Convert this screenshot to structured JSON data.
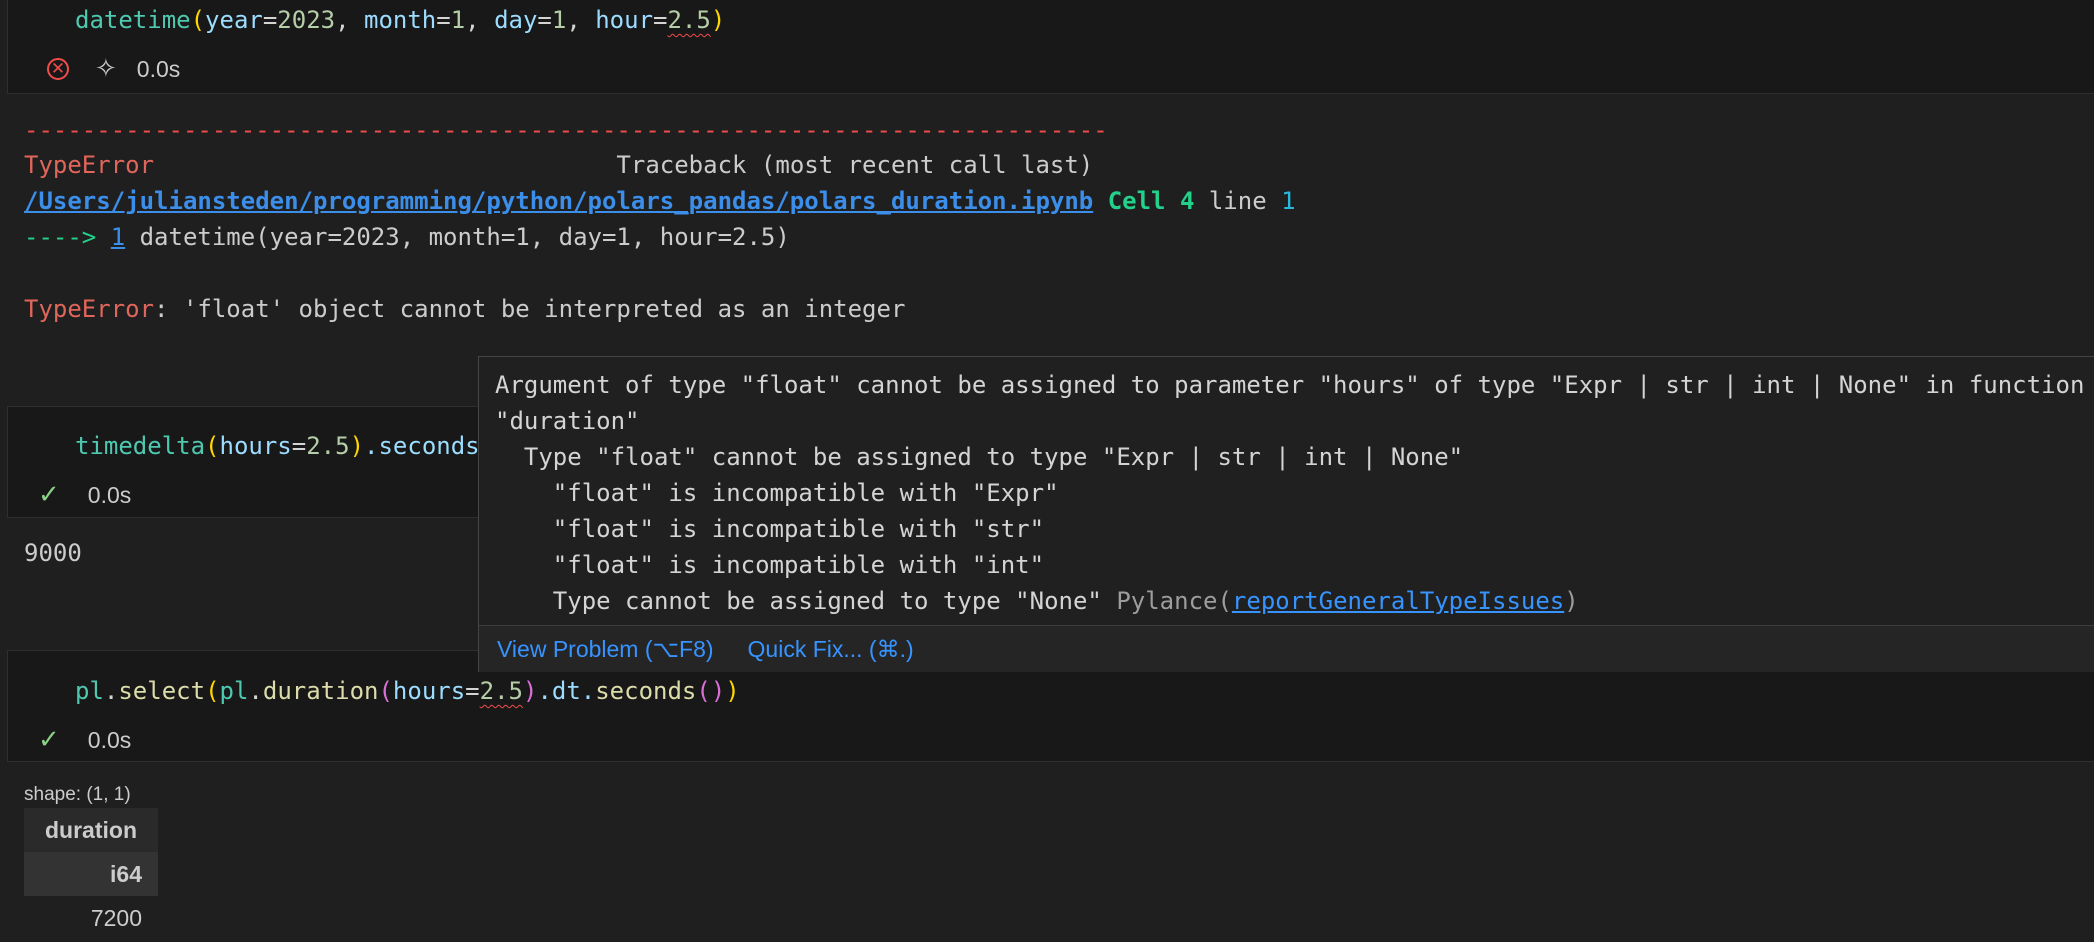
{
  "cell1": {
    "code": {
      "fn": "datetime",
      "open": "(",
      "p1": "year",
      "eq": "=",
      "v1": "2023",
      "comma": ", ",
      "p2": "month",
      "v2": "1",
      "p3": "day",
      "v3": "1",
      "p4": "hour",
      "v4": "2.5",
      "close": ")"
    },
    "time": "0.0s"
  },
  "error_output": {
    "dashes": "---------------------------------------------------------------------------",
    "error_type": "TypeError",
    "traceback_label": "Traceback (most recent call last)",
    "file_path": "/Users/juliansteden/programming/python/polars_pandas/polars_duration.ipynb",
    "cell_label": "Cell",
    "cell_num": "4",
    "line_label": "line",
    "line_num": "1",
    "arrow": "---->",
    "arrow_line": "1",
    "arrow_code": " datetime(year=2023, month=1, day=1, hour=2.5)",
    "message": ": 'float' object cannot be interpreted as an integer"
  },
  "cell2": {
    "code": {
      "fn": "timedelta",
      "open": "(",
      "p1": "hours",
      "eq": "=",
      "v1": "2.5",
      "close": ")",
      "attr": ".seconds"
    },
    "time": "0.0s",
    "output": "9000"
  },
  "cell3": {
    "code": {
      "obj": "pl",
      "dot1": ".",
      "fn1": "select",
      "open1": "(",
      "obj2": "pl",
      "dot2": ".",
      "fn2": "duration",
      "open2": "(",
      "p1": "hours",
      "eq": "=",
      "v1": "2.5",
      "close2": ")",
      "dt": ".dt.",
      "fn3": "seconds",
      "call3": "()",
      "close1": ")"
    },
    "time": "0.0s"
  },
  "hover": {
    "line1": "Argument of type \"float\" cannot be assigned to parameter \"hours\" of type \"Expr | str | int | None\" in function",
    "line2": "\"duration\"",
    "line3": "  Type \"float\" cannot be assigned to type \"Expr | str | int | None\"",
    "line4": "    \"float\" is incompatible with \"Expr\"",
    "line5": "    \"float\" is incompatible with \"str\"",
    "line6": "    \"float\" is incompatible with \"int\"",
    "line7": "    Type cannot be assigned to type \"None\" ",
    "source": "Pylance(",
    "rule": "reportGeneralTypeIssues",
    "source_close": ")",
    "view_problem": "View Problem (⌥F8)",
    "quick_fix": "Quick Fix... (⌘.)"
  },
  "dataframe": {
    "shape": "shape: (1, 1)",
    "column": "duration",
    "dtype": "i64",
    "value": "7200"
  },
  "colors": {
    "background": "#1f1f1f",
    "error": "#f14c4c",
    "success": "#89d185",
    "link": "#3794ff"
  },
  "icons": {
    "error": "error-circle-icon",
    "sparkle": "sparkle-icon",
    "check": "check-icon"
  }
}
